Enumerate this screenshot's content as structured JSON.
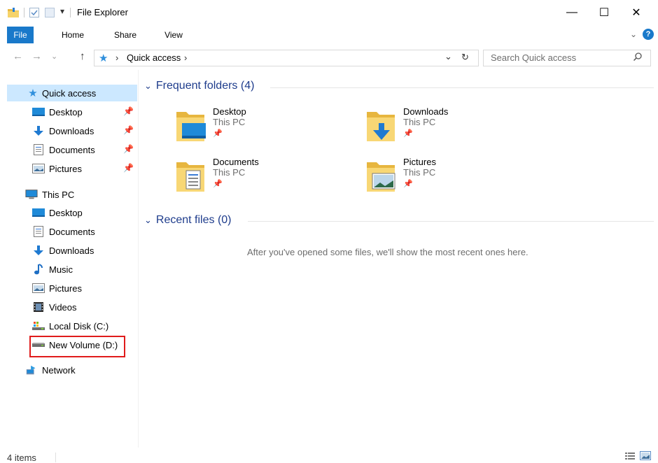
{
  "window": {
    "title": "File Explorer",
    "minimize": "—",
    "maximize": "☐",
    "close": "✕"
  },
  "ribbon": {
    "tabs": [
      {
        "label": "File"
      },
      {
        "label": "Home"
      },
      {
        "label": "Share"
      },
      {
        "label": "View"
      }
    ]
  },
  "address": {
    "path_separator_1": "›",
    "path": "Quick access",
    "path_separator_2": "›",
    "dropdown": "⌄",
    "refresh": "↻"
  },
  "search": {
    "placeholder": "Search Quick access",
    "icon": "⚲"
  },
  "nav": {
    "quick_access": {
      "label": "Quick access"
    },
    "quick_items": [
      {
        "label": "Desktop"
      },
      {
        "label": "Downloads"
      },
      {
        "label": "Documents"
      },
      {
        "label": "Pictures"
      }
    ],
    "this_pc": {
      "label": "This PC"
    },
    "pc_items": [
      {
        "label": "Desktop"
      },
      {
        "label": "Documents"
      },
      {
        "label": "Downloads"
      },
      {
        "label": "Music"
      },
      {
        "label": "Pictures"
      },
      {
        "label": "Videos"
      },
      {
        "label": "Local Disk (C:)"
      },
      {
        "label": "New Volume (D:)"
      }
    ],
    "network": {
      "label": "Network"
    },
    "highlight_color": "#e01b1b"
  },
  "content": {
    "frequent_header": "Frequent folders (4)",
    "recent_header": "Recent files (0)",
    "recent_empty": "After you've opened some files, we'll show the most recent ones here.",
    "folders": [
      {
        "name": "Desktop",
        "location": "This PC"
      },
      {
        "name": "Downloads",
        "location": "This PC"
      },
      {
        "name": "Documents",
        "location": "This PC"
      },
      {
        "name": "Pictures",
        "location": "This PC"
      }
    ]
  },
  "status": {
    "items": "4 items"
  }
}
